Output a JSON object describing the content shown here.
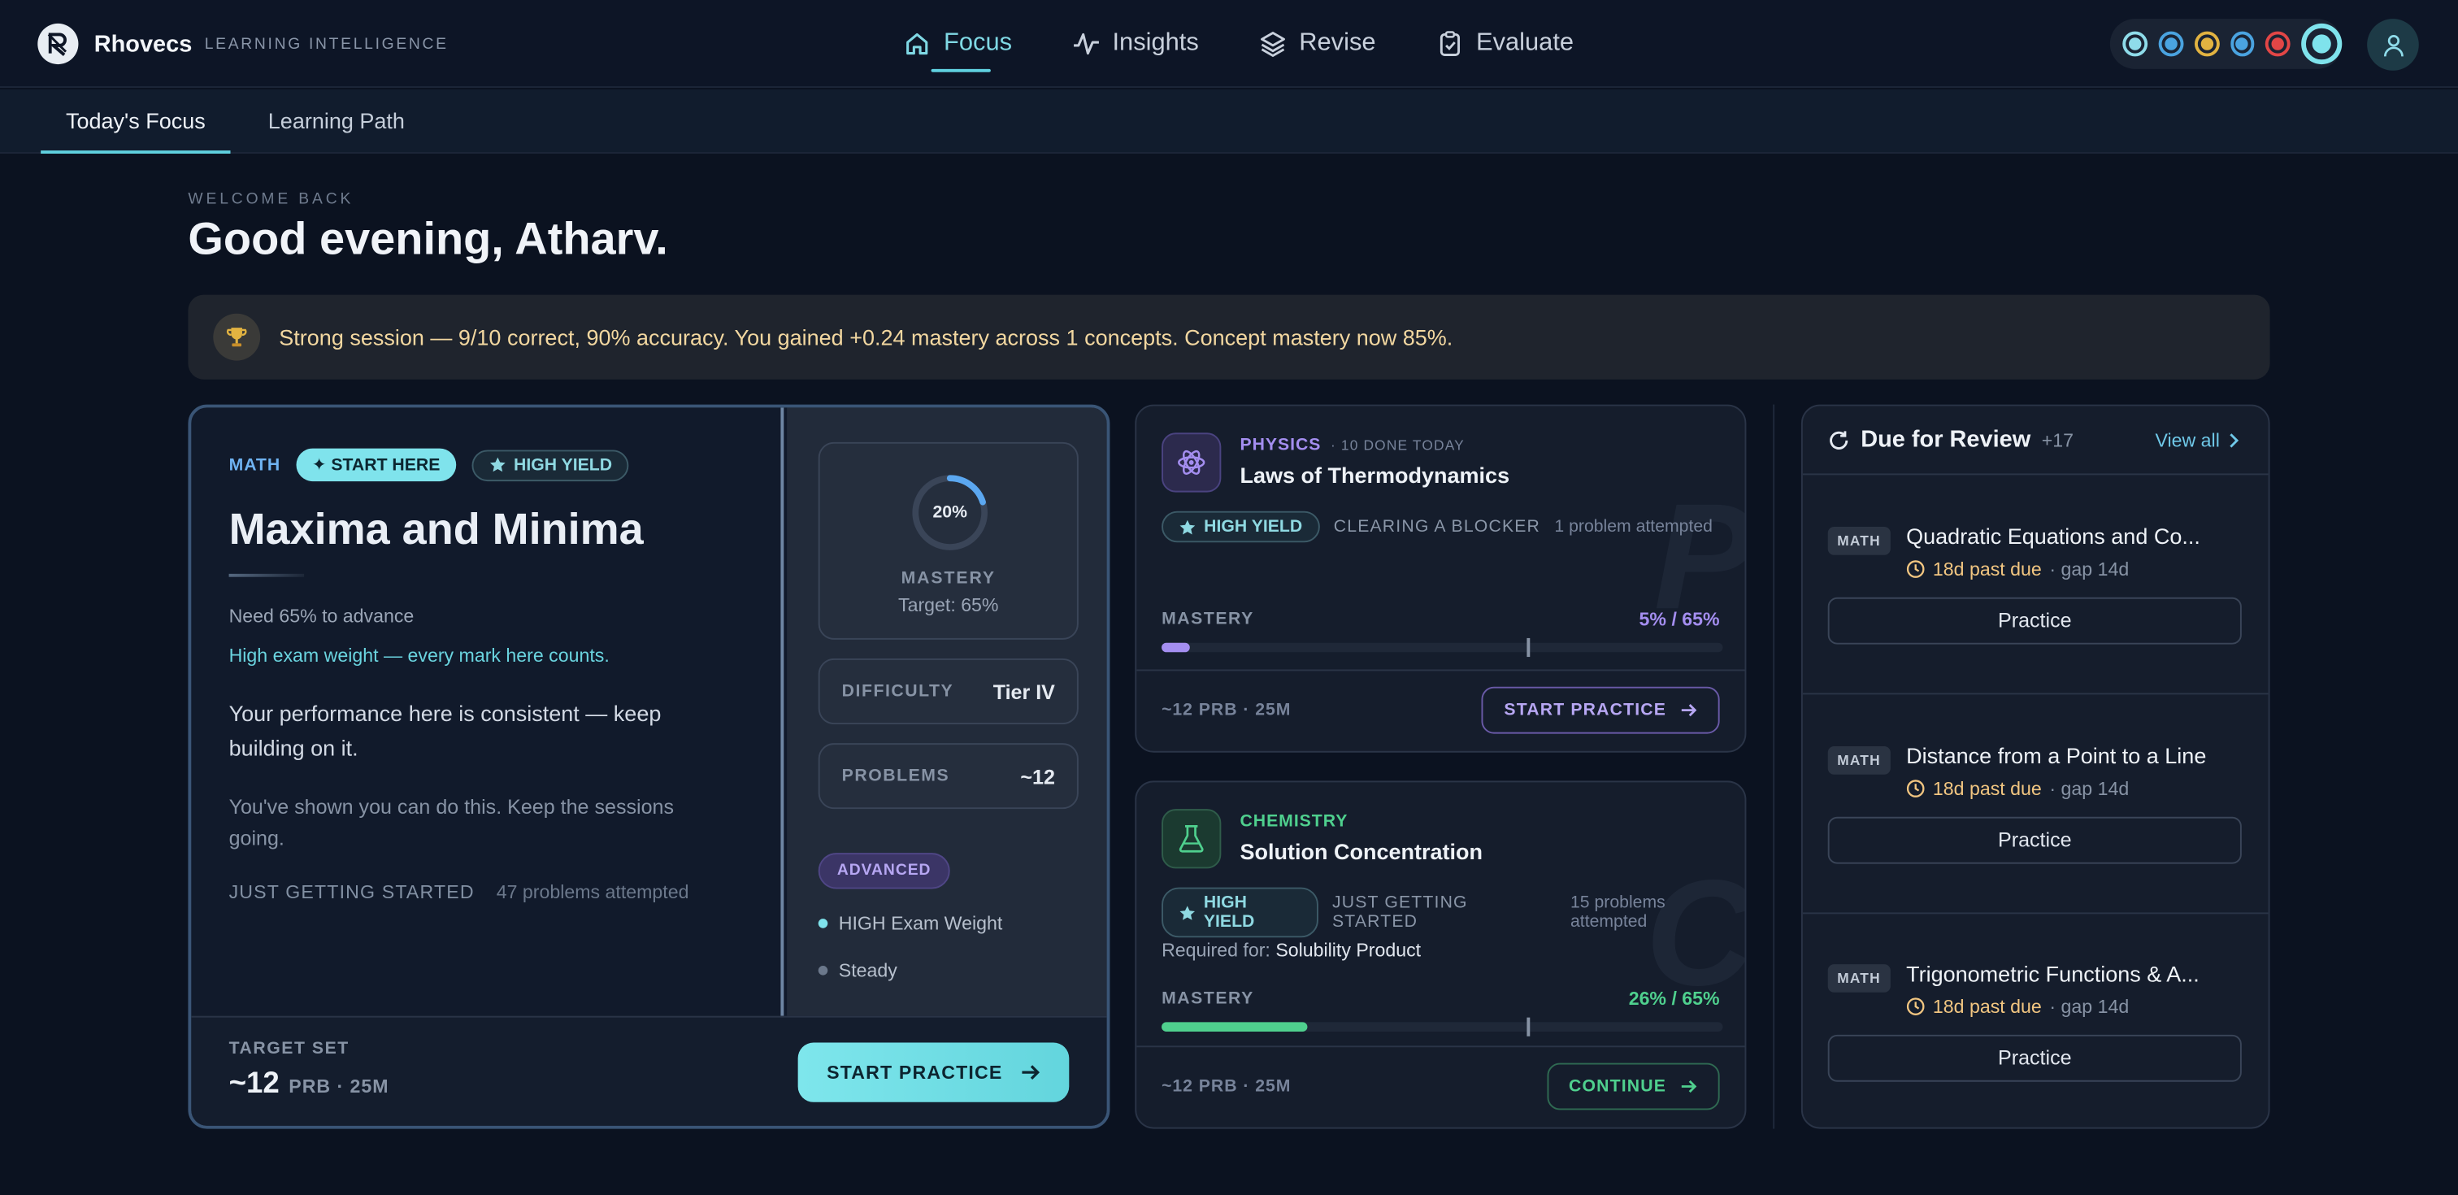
{
  "brand": {
    "name": "Rhovecs",
    "tagline": "LEARNING INTELLIGENCE"
  },
  "nav": [
    {
      "label": "Focus",
      "icon": "home-icon",
      "active": true
    },
    {
      "label": "Insights",
      "icon": "pulse-icon",
      "active": false
    },
    {
      "label": "Revise",
      "icon": "layers-icon",
      "active": false
    },
    {
      "label": "Evaluate",
      "icon": "clipboard-check-icon",
      "active": false
    }
  ],
  "status_dots": [
    "#8fdcea",
    "#4aa3e0",
    "#e2b341",
    "#4aa3e0",
    "#e24646",
    "#7fe3ec"
  ],
  "subtabs": [
    {
      "label": "Today's Focus",
      "active": true
    },
    {
      "label": "Learning Path",
      "active": false
    }
  ],
  "welcome": {
    "kicker": "WELCOME BACK",
    "greeting": "Good evening, Atharv."
  },
  "banner": {
    "text": "Strong session — 9/10 correct, 90% accuracy. You gained +0.24 mastery across 1 concepts. Concept mastery now 85%."
  },
  "focus": {
    "subject": "MATH",
    "chip_start": "✦ START HERE",
    "chip_yield": "HIGH YIELD",
    "title": "Maxima and Minima",
    "need": "Need 65% to advance",
    "weight": "High exam weight — every mark here counts.",
    "performance": "Your performance here is consistent — keep building on it.",
    "encouragement": "You've shown you can do this. Keep the sessions going.",
    "status": "JUST GETTING STARTED",
    "attempted": "47 problems attempted",
    "mastery_pct": 20,
    "mastery_text": "20%",
    "mastery_label": "MASTERY",
    "mastery_target": "Target: 65%",
    "difficulty_label": "DIFFICULTY",
    "difficulty_value": "Tier IV",
    "problems_label": "PROBLEMS",
    "problems_value": "~12",
    "level_badge": "ADVANCED",
    "bullets": [
      "HIGH Exam Weight",
      "Steady"
    ],
    "target_label": "TARGET SET",
    "target_value": "~12",
    "target_unit": "PRB · 25M",
    "cta": "START PRACTICE"
  },
  "concepts": [
    {
      "subject": "PHYSICS",
      "meta": "· 10 DONE TODAY",
      "title": "Laws of Thermodynamics",
      "chip": "HIGH YIELD",
      "status": "CLEARING A BLOCKER",
      "attempted": "1 problem attempted",
      "required_label": "",
      "required_value": "",
      "mastery_label": "MASTERY",
      "mastery_text": "5% / 65%",
      "mastery": 5,
      "target": 65,
      "watermark": "P",
      "footer": "~12 PRB · 25M",
      "cta": "START PRACTICE",
      "color": "#a48ef0"
    },
    {
      "subject": "CHEMISTRY",
      "meta": "",
      "title": "Solution Concentration",
      "chip": "HIGH YIELD",
      "status": "JUST GETTING STARTED",
      "attempted": "15 problems attempted",
      "required_label": "Required for:",
      "required_value": "Solubility Product",
      "mastery_label": "MASTERY",
      "mastery_text": "26% / 65%",
      "mastery": 26,
      "target": 65,
      "watermark": "C",
      "footer": "~12 PRB · 25M",
      "cta": "CONTINUE",
      "color": "#4fd08e"
    }
  ],
  "review": {
    "title": "Due for Review",
    "count": "+17",
    "view_all": "View all",
    "items": [
      {
        "tag": "MATH",
        "name": "Quadratic Equations and Co...",
        "due": "18d past due",
        "gap": "· gap 14d",
        "action": "Practice"
      },
      {
        "tag": "MATH",
        "name": "Distance from a Point to a Line",
        "due": "18d past due",
        "gap": "· gap 14d",
        "action": "Practice"
      },
      {
        "tag": "MATH",
        "name": "Trigonometric Functions & A...",
        "due": "18d past due",
        "gap": "· gap 14d",
        "action": "Practice"
      }
    ]
  }
}
